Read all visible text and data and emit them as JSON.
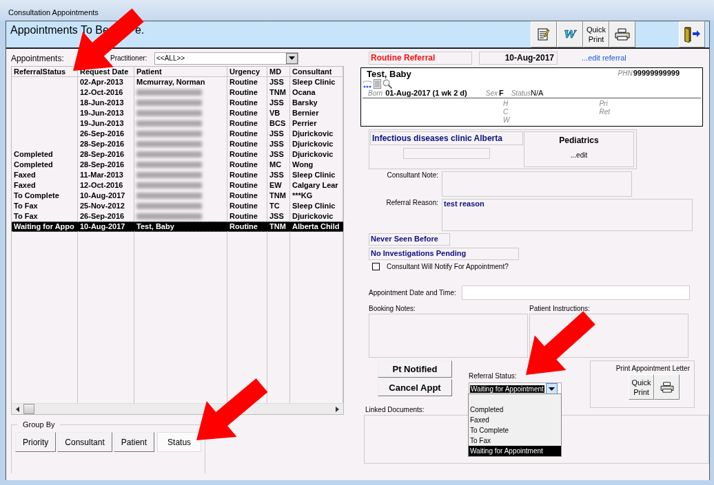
{
  "window": {
    "title": "Consultation Appointments"
  },
  "header": {
    "title": "Appointments To Be",
    "title_tail": "e.",
    "toolbar": [
      {
        "kind": "edit"
      },
      {
        "kind": "word",
        "label": "W"
      },
      {
        "kind": "text",
        "label": "Quick Print"
      },
      {
        "kind": "print"
      }
    ],
    "exit": {
      "kind": "exit"
    }
  },
  "appointments": {
    "label": "Appointments:",
    "practitioner_label": "Practitioner:",
    "practitioner_value": "<<ALL>>"
  },
  "table": {
    "columns": [
      "ReferralStatus",
      "Request Date",
      "Patient",
      "Urgency",
      "MD",
      "Consultant"
    ],
    "rows": [
      {
        "date": "02-Apr-2013",
        "patient": "Mcmurray, Norman",
        "urgency": "Routine",
        "md": "JSS",
        "consultant": "Sleep Clinic",
        "blurred": false,
        "selected": false
      },
      {
        "date": "12-Oct-2016",
        "urgency": "Routine",
        "md": "TNM",
        "consultant": "Ocana",
        "blurred": true,
        "selected": false
      },
      {
        "date": "18-Jun-2013",
        "urgency": "Routine",
        "md": "JSS",
        "consultant": "Barsky",
        "blurred": true,
        "selected": false
      },
      {
        "date": "19-Jun-2013",
        "urgency": "Routine",
        "md": "VB",
        "consultant": "Bernier",
        "blurred": true,
        "selected": false
      },
      {
        "date": "19-Jun-2013",
        "urgency": "Routine",
        "md": "BCS",
        "consultant": "Perrier",
        "blurred": true,
        "selected": false
      },
      {
        "date": "26-Sep-2016",
        "urgency": "Routine",
        "md": "JSS",
        "consultant": "Djurickovic",
        "blurred": true,
        "selected": false
      },
      {
        "date": "28-Sep-2016",
        "urgency": "Routine",
        "md": "JSS",
        "consultant": "Djurickovic",
        "blurred": true,
        "selected": false
      },
      {
        "status": "Completed",
        "date": "28-Sep-2016",
        "urgency": "Routine",
        "md": "JSS",
        "consultant": "Djurickovic",
        "blurred": true,
        "selected": false
      },
      {
        "status": "Completed",
        "date": "28-Sep-2016",
        "urgency": "Routine",
        "md": "MC",
        "consultant": "Wong",
        "blurred": true,
        "selected": false
      },
      {
        "status": "Faxed",
        "date": "11-Mar-2013",
        "urgency": "Routine",
        "md": "JSS",
        "consultant": "Sleep Clinic",
        "blurred": true,
        "selected": false
      },
      {
        "status": "Faxed",
        "date": "12-Oct-2016",
        "urgency": "Routine",
        "md": "EW",
        "consultant": "Calgary Lear",
        "blurred": true,
        "selected": false
      },
      {
        "status": "To Complete",
        "date": "10-Aug-2017",
        "urgency": "Routine",
        "md": "TNM",
        "consultant": "***KG",
        "blurred": true,
        "selected": false
      },
      {
        "status": "To Fax",
        "date": "25-Nov-2012",
        "urgency": "Routine",
        "md": "TC",
        "consultant": "Sleep Clinic",
        "blurred": true,
        "selected": false
      },
      {
        "status": "To Fax",
        "date": "26-Sep-2016",
        "urgency": "Routine",
        "md": "JSS",
        "consultant": "Djurickovic",
        "blurred": true,
        "selected": false
      },
      {
        "status": "Waiting for Appo",
        "date": "10-Aug-2017",
        "patient": "Test, Baby",
        "urgency": "Routine",
        "md": "TNM",
        "consultant": "Alberta Child",
        "blurred": false,
        "selected": true
      }
    ]
  },
  "group_by": {
    "legend": "Group By",
    "buttons": [
      {
        "label": "Priority",
        "selected": false
      },
      {
        "label": "Consultant",
        "selected": false
      },
      {
        "label": "Patient",
        "selected": false
      },
      {
        "label": "Status",
        "selected": true
      }
    ]
  },
  "referral": {
    "type": "Routine Referral",
    "date": "10-Aug-2017",
    "edit_link": "...edit referral"
  },
  "patient": {
    "name": "Test, Baby",
    "phn_label": "PHN",
    "phn": "99999999999",
    "born_label": "Born",
    "born": "01-Aug-2017 (1 wk 2 d)",
    "sex_label": "Sex",
    "sex": "F",
    "status_label": "Status",
    "status": "N/A",
    "phones": [
      "H",
      "C",
      "W"
    ],
    "other": [
      "Pri",
      "Ret"
    ]
  },
  "clinic": {
    "name": "Infectious diseases clinic Alberta",
    "specialty": "Pediatrics",
    "edit": "...edit"
  },
  "consultant_note": {
    "label": "Consultant Note:"
  },
  "referral_reason": {
    "label": "Referral Reason:",
    "value": "test reason"
  },
  "flags": [
    "Never Seen Before",
    "No Investigations Pending"
  ],
  "notify": {
    "label": "Consultant Will Notify For Appointment?",
    "checked": false
  },
  "appointment_date": {
    "label": "Appointment Date and Time:"
  },
  "booking_notes": {
    "label": "Booking Notes:"
  },
  "patient_instructions": {
    "label": "Patient Instructions:"
  },
  "actions": [
    "Pt Notified",
    "Cancel Appt"
  ],
  "referral_status": {
    "label": "Referral Status:",
    "value": "Waiting for Appointment",
    "options": [
      {
        "label": "Completed",
        "selected": false
      },
      {
        "label": "Faxed",
        "selected": false
      },
      {
        "label": "To Complete",
        "selected": false
      },
      {
        "label": "To Fax",
        "selected": false
      },
      {
        "label": "Waiting for Appointment",
        "selected": true
      }
    ]
  },
  "print_letter": {
    "title": "Print Appointment Letter",
    "quick_print": "Quick Print"
  },
  "linked_documents": {
    "label": "Linked Documents:"
  }
}
